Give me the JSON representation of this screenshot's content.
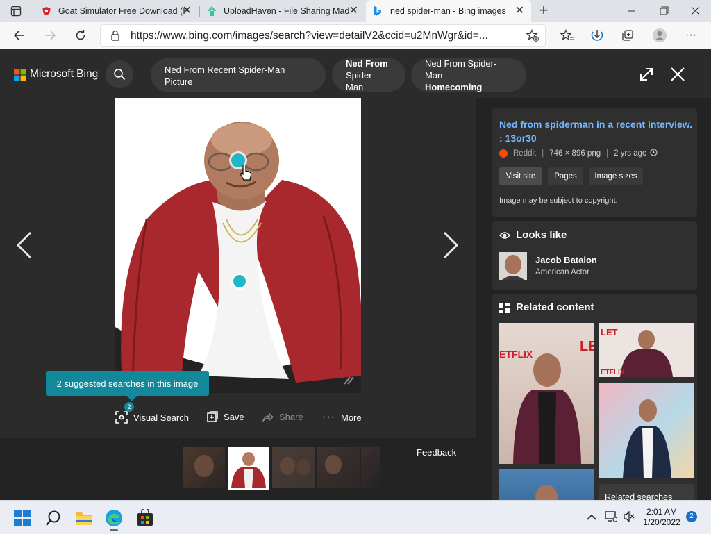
{
  "browser": {
    "tabs": [
      {
        "title": "Goat Simulator Free Download (I",
        "active": false
      },
      {
        "title": "UploadHaven - File Sharing Mad",
        "active": false
      },
      {
        "title": "ned spider-man - Bing images",
        "active": true
      }
    ],
    "url": "https://www.bing.com/images/search?view=detailV2&ccid=u2MnWgr&id=..."
  },
  "bing": {
    "logo_text": "Microsoft Bing",
    "pills": [
      {
        "line1": "Ned From Recent Spider-Man Picture",
        "line2": ""
      },
      {
        "line1": "Ned From",
        "line2": "Spider-Man"
      },
      {
        "line1": "Ned From Spider-Man",
        "line2": "Homecoming"
      }
    ]
  },
  "viewer": {
    "tooltip": "2 suggested searches in this image",
    "visual_search_badge": "2",
    "toolbar": {
      "visual_search": "Visual Search",
      "save": "Save",
      "share": "Share",
      "more": "More"
    },
    "feedback": "Feedback"
  },
  "panel": {
    "title": "Ned from spiderman in a recent interview. : 13or30",
    "source": "Reddit",
    "dims": "746 × 896 png",
    "age": "2 yrs ago",
    "buttons": [
      "Visit site",
      "Pages",
      "Image sizes"
    ],
    "copyright": "Image may be subject to copyright.",
    "looks_like_header": "Looks like",
    "person": {
      "name": "Jacob Batalon",
      "role": "American Actor"
    },
    "related_header": "Related content",
    "related_searches": "Related searches"
  },
  "taskbar": {
    "time": "2:01 AM",
    "date": "1/20/2022",
    "notification_count": "2"
  },
  "colors": {
    "accent_teal": "#1fb8c9",
    "link_blue": "#75b8ff",
    "bing_dark": "#2b2b2b"
  }
}
